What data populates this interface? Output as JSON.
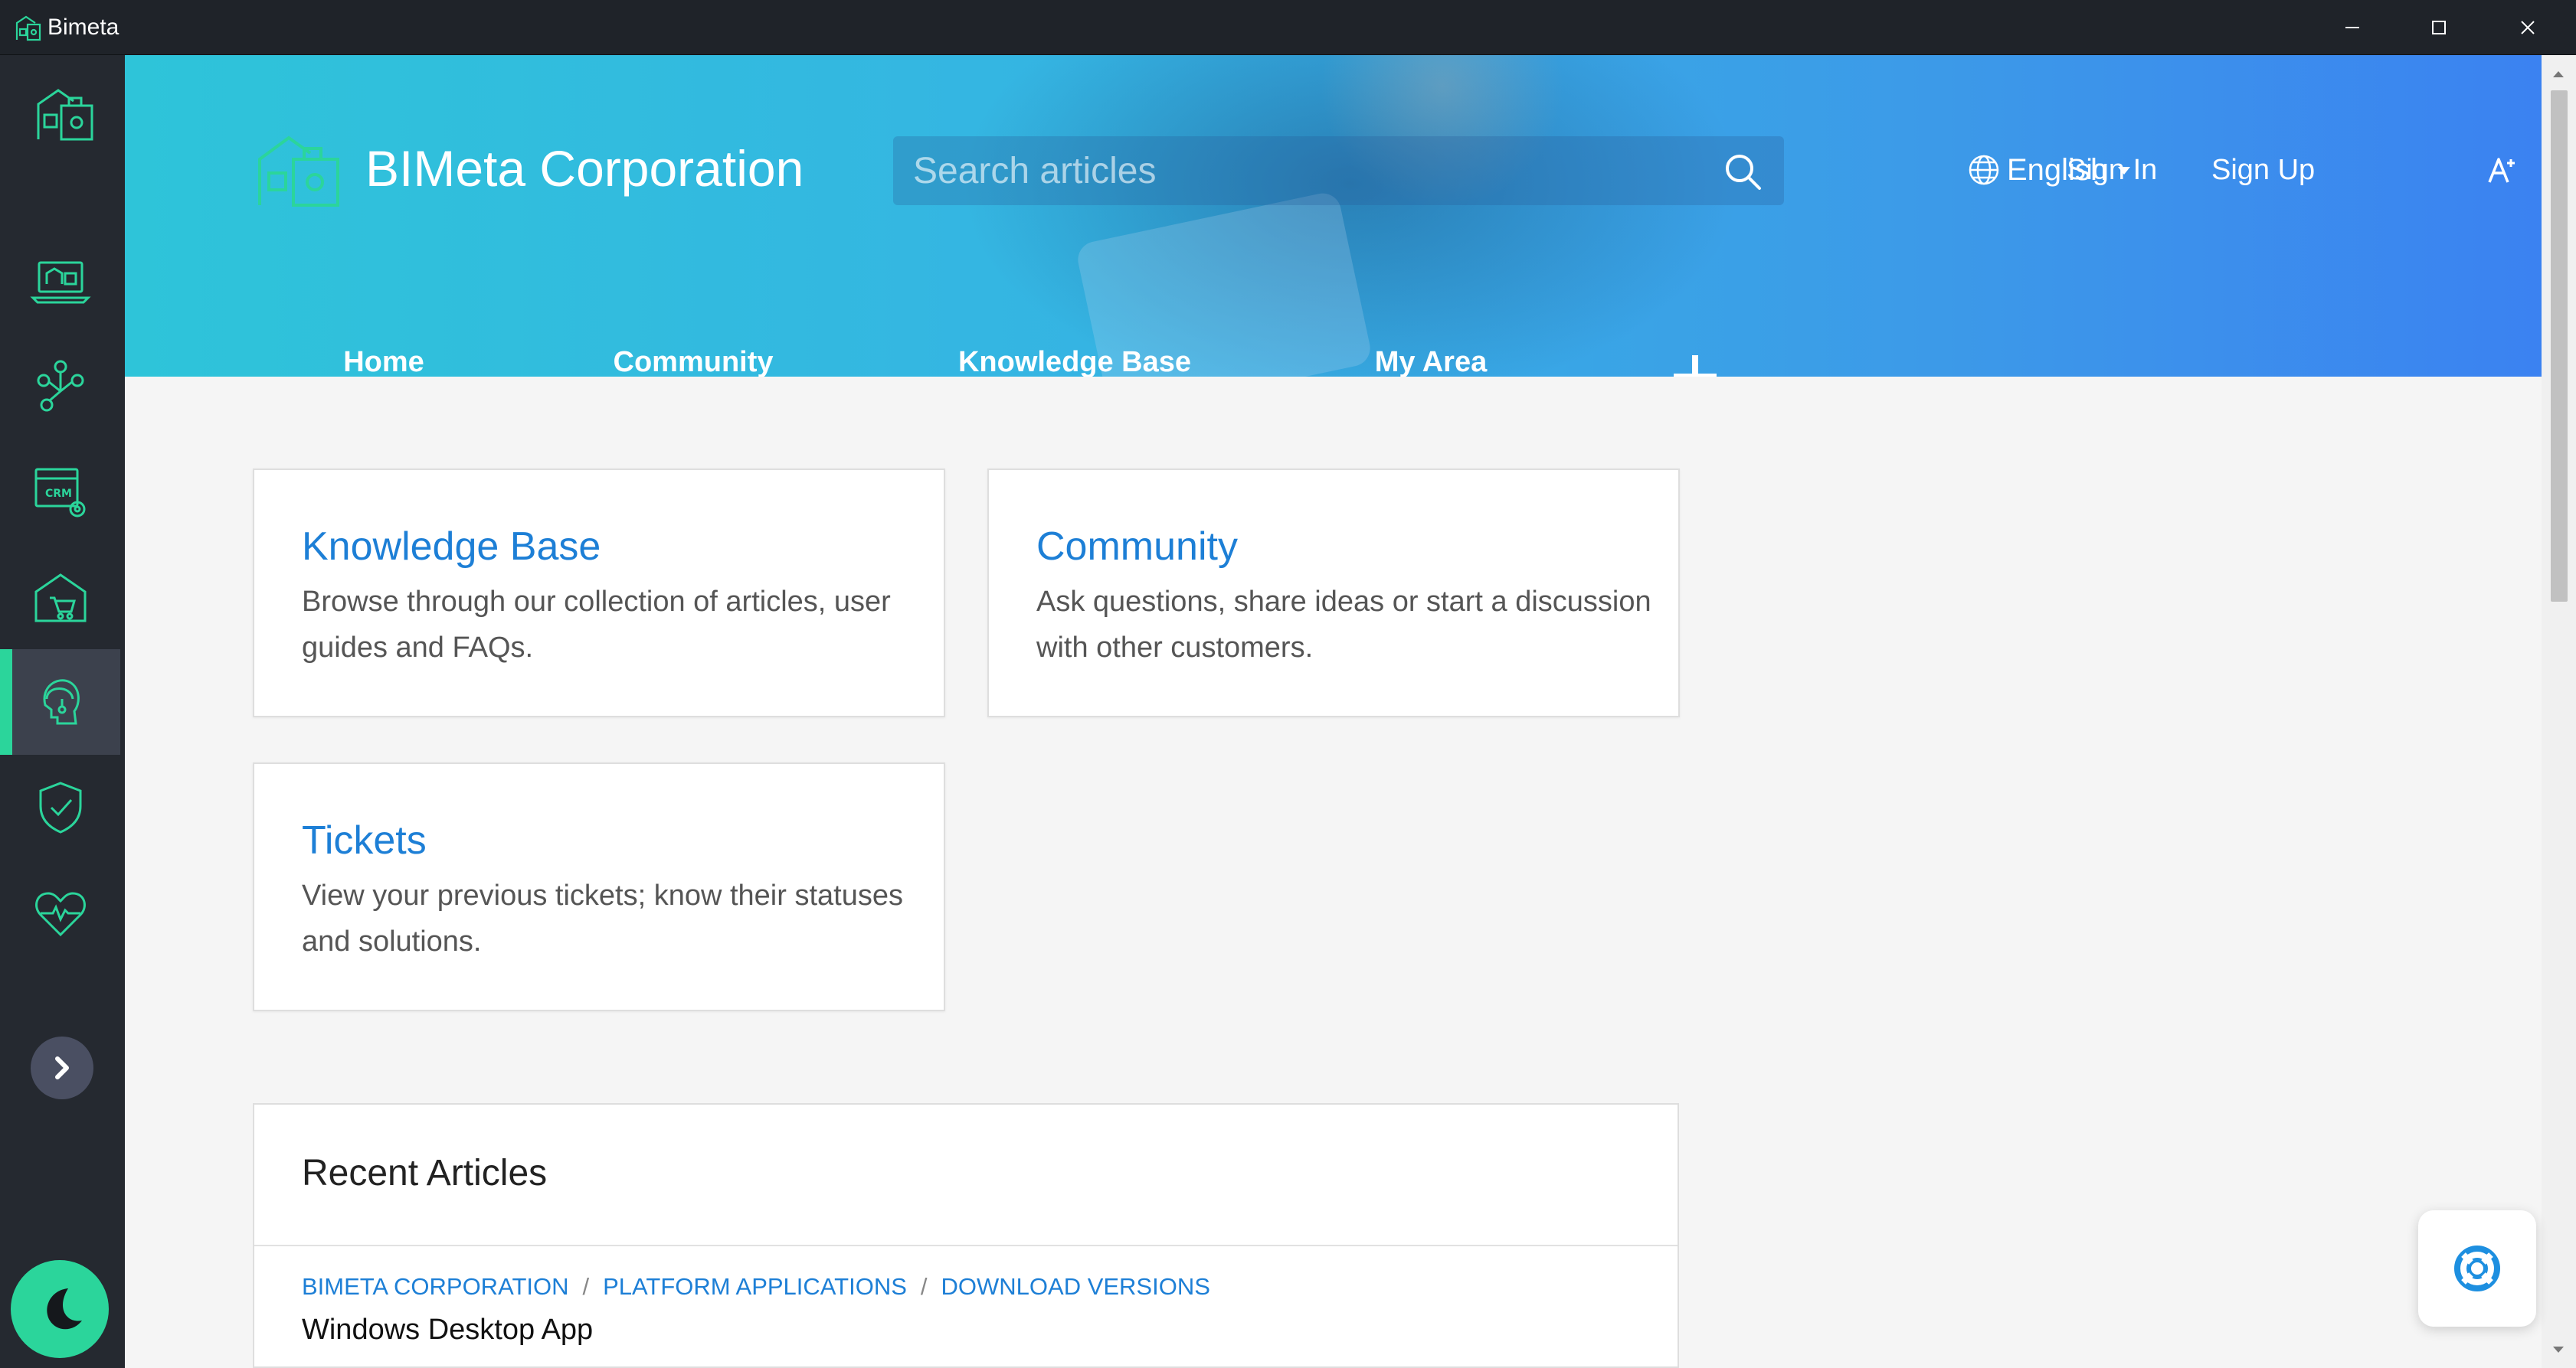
{
  "window": {
    "title": "Bimeta",
    "controls": [
      "minimize-icon",
      "maximize-icon",
      "close-icon"
    ]
  },
  "rail": {
    "items": [
      {
        "icon": "laptop-dashboard-icon"
      },
      {
        "icon": "org-network-icon"
      },
      {
        "icon": "crm-settings-icon"
      },
      {
        "icon": "store-cart-icon"
      },
      {
        "icon": "support-agent-icon",
        "active": true
      },
      {
        "icon": "shield-check-icon"
      },
      {
        "icon": "heart-pulse-icon"
      }
    ],
    "accent": "#2bd59b"
  },
  "header": {
    "brand": "BIMeta Corporation",
    "search_placeholder": "Search articles",
    "language": "English",
    "sign_in": "Sign In",
    "sign_up": "Sign Up",
    "nav": [
      {
        "label": "Home",
        "active": true
      },
      {
        "label": "Community"
      },
      {
        "label": "Knowledge Base"
      },
      {
        "label": "My Area"
      }
    ],
    "active_tab_color": "#ea2a57"
  },
  "cards": [
    {
      "title": "Knowledge Base",
      "desc": "Browse through our collection of articles, user guides and FAQs."
    },
    {
      "title": "Community",
      "desc": "Ask questions, share ideas or start a discussion with other customers."
    },
    {
      "title": "Tickets",
      "desc": "View your previous tickets; know their statuses and solutions."
    }
  ],
  "recent": {
    "title": "Recent Articles",
    "breadcrumb": [
      "BIMETA CORPORATION",
      "PLATFORM APPLICATIONS",
      "DOWNLOAD VERSIONS"
    ],
    "article_title": "Windows Desktop App"
  },
  "colors": {
    "link": "#1d7fd6",
    "banner_start": "#2ec4d9",
    "banner_end": "#3b82f1"
  }
}
